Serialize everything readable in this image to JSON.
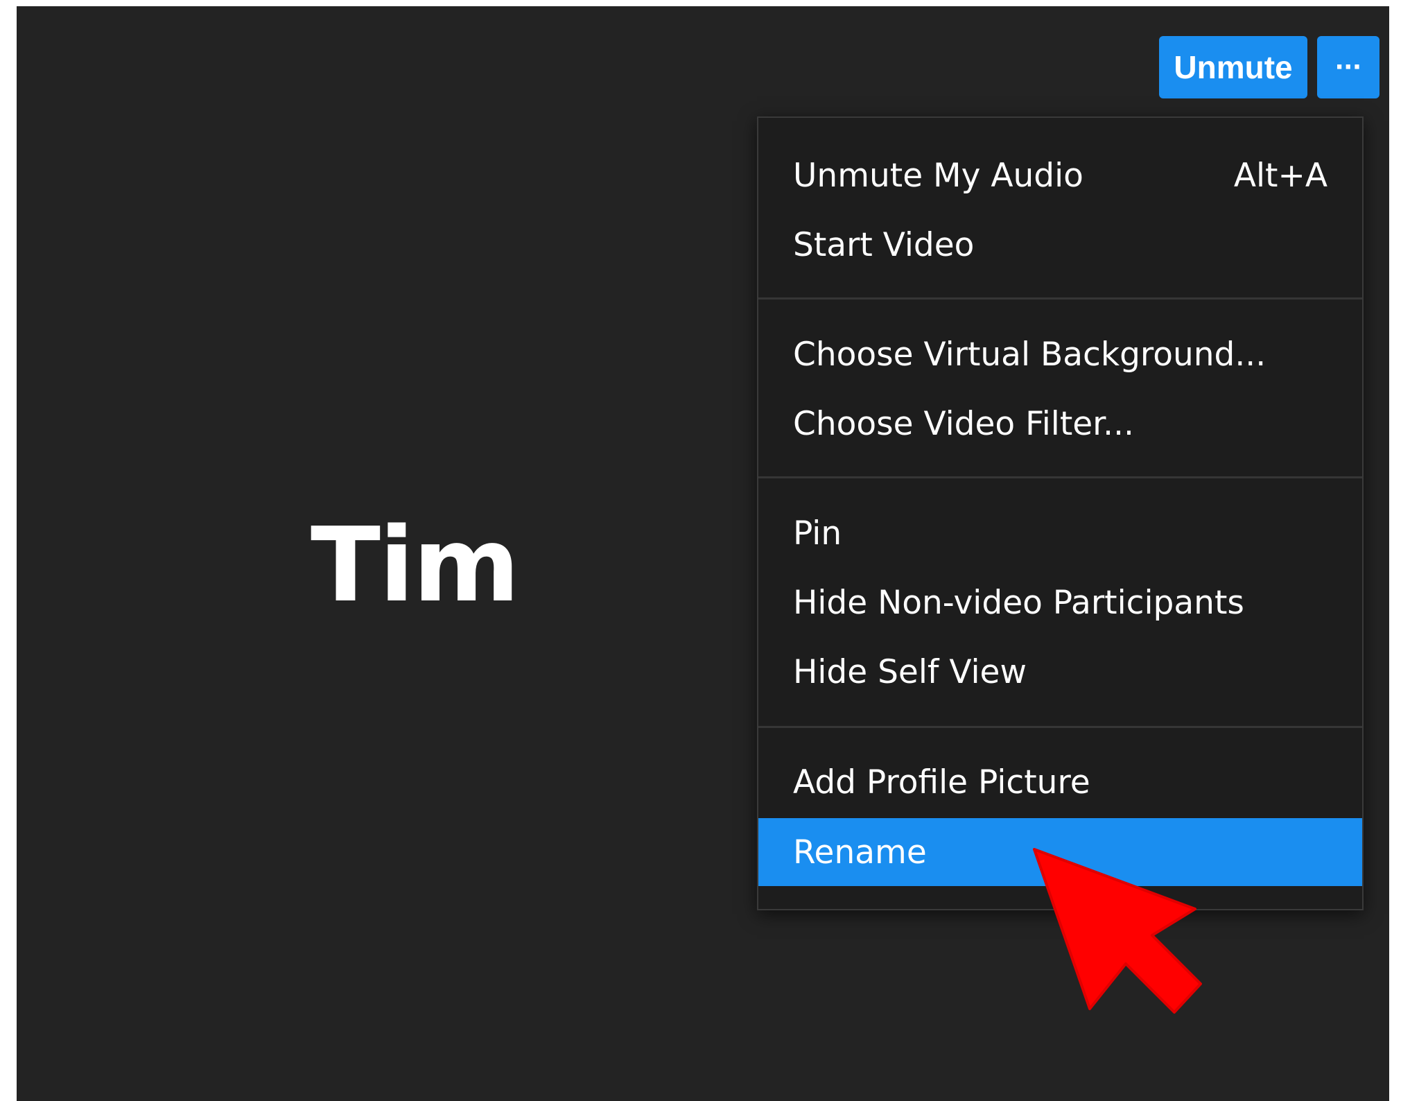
{
  "participant": {
    "name": "Tim"
  },
  "toolbar": {
    "unmute_label": "Unmute",
    "more_label": "···"
  },
  "menu": {
    "groups": [
      {
        "items": [
          {
            "label": "Unmute My Audio",
            "shortcut": "Alt+A"
          },
          {
            "label": "Start Video"
          }
        ]
      },
      {
        "items": [
          {
            "label": "Choose Virtual Background..."
          },
          {
            "label": "Choose Video Filter..."
          }
        ]
      },
      {
        "items": [
          {
            "label": "Pin"
          },
          {
            "label": "Hide Non-video Participants"
          },
          {
            "label": "Hide Self View"
          }
        ]
      },
      {
        "items": [
          {
            "label": "Add Profile Picture"
          },
          {
            "label": "Rename",
            "selected": true
          }
        ]
      }
    ]
  },
  "colors": {
    "background": "#232323",
    "accent": "#1a8ef0",
    "menu_background": "#1d1d1d",
    "pointer": "#ff0000"
  },
  "annotation": {
    "icon": "red-arrow-pointer-icon"
  }
}
